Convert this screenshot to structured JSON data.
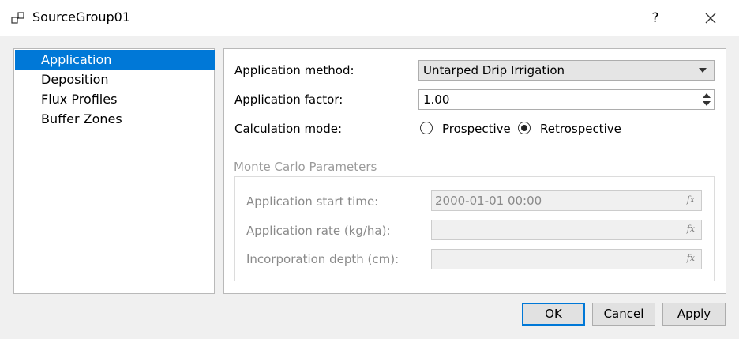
{
  "window": {
    "title": "SourceGroup01",
    "help_label": "?"
  },
  "nav": {
    "items": [
      "Application",
      "Deposition",
      "Flux Profiles",
      "Buffer Zones"
    ],
    "selected_index": 0
  },
  "form": {
    "method_label": "Application method:",
    "method_value": "Untarped Drip Irrigation",
    "factor_label": "Application factor:",
    "factor_value": "1.00",
    "calc_label": "Calculation mode:",
    "calc_options": [
      "Prospective",
      "Retrospective"
    ],
    "calc_selected": "Retrospective"
  },
  "monte_carlo": {
    "title": "Monte Carlo Parameters",
    "start_label": "Application start time:",
    "start_value": "2000-01-01 00:00",
    "rate_label": "Application rate (kg/ha):",
    "rate_value": "",
    "depth_label": "Incorporation depth (cm):",
    "depth_value": "",
    "fx_label": "fx"
  },
  "buttons": {
    "ok": "OK",
    "cancel": "Cancel",
    "apply": "Apply"
  },
  "colors": {
    "selection": "#0078d7",
    "disabled_text": "#8a8a8a"
  }
}
